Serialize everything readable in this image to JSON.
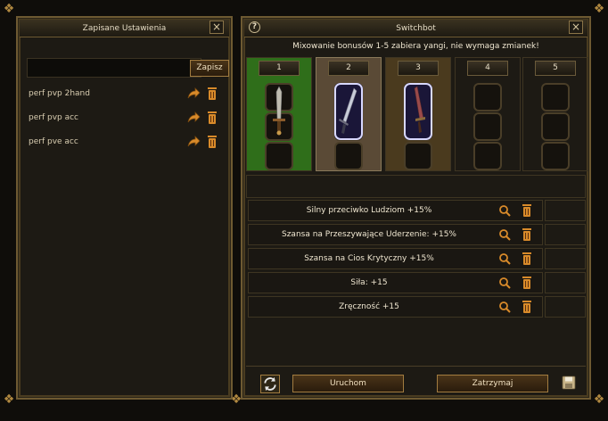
{
  "saved_window": {
    "title": "Zapisane Ustawienia",
    "close_glyph": "×",
    "name_input_value": "",
    "save_label": "Zapisz",
    "presets": [
      {
        "label": "perf pvp 2hand"
      },
      {
        "label": "perf pvp acc"
      },
      {
        "label": "perf pve acc"
      }
    ]
  },
  "switchbot": {
    "title": "Switchbot",
    "help_glyph": "?",
    "close_glyph": "×",
    "info": "Mixowanie bonusów 1-5 zabiera yangi, nie wymaga zmianek!",
    "slots": [
      {
        "num": "1",
        "state": "active",
        "item": "sword-icon"
      },
      {
        "num": "2",
        "state": "selected",
        "item": "glowing-blade-icon"
      },
      {
        "num": "3",
        "state": "filled",
        "item": "red-blade-icon"
      },
      {
        "num": "4",
        "state": "empty"
      },
      {
        "num": "5",
        "state": "empty"
      }
    ],
    "bonuses": [
      "Silny przeciwko Ludziom +15%",
      "Szansa na Przeszywające Uderzenie: +15%",
      "Szansa na Cios Krytyczny +15%",
      "Siła: +15",
      "Zręczność +15"
    ],
    "start_label": "Uruchom",
    "stop_label": "Zatrzymaj"
  },
  "colors": {
    "active_slot": "#2f6e1a",
    "selected_slot": "#5a4a36",
    "filled_slot": "#4a3a1e",
    "accent": "#a27c40"
  }
}
